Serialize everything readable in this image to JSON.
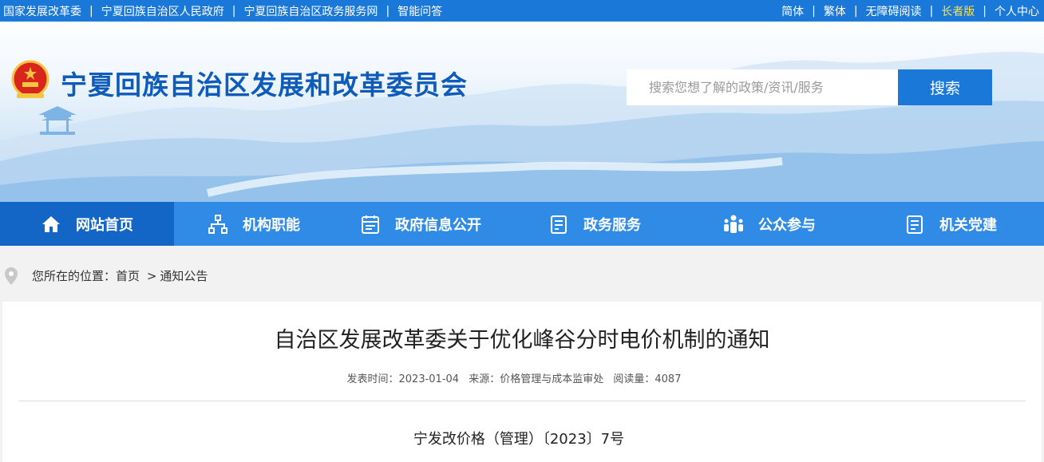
{
  "topbar": {
    "links": [
      "国家发展改革委",
      "宁夏回族自治区人民政府",
      "宁夏回族自治区政务服务网",
      "智能问答"
    ],
    "right": [
      "简体",
      "繁体",
      "无障碍阅读",
      "长者版",
      "个人中心"
    ]
  },
  "header": {
    "site_title": "宁夏回族自治区发展和改革委员会",
    "emblem_icon": "national-emblem-icon",
    "search_placeholder": "搜索您想了解的政策/资讯/服务",
    "search_button": "搜索"
  },
  "nav": {
    "items": [
      {
        "label": "网站首页",
        "icon": "home-icon"
      },
      {
        "label": "机构职能",
        "icon": "org-chart-icon"
      },
      {
        "label": "政府信息公开",
        "icon": "calendar-doc-icon"
      },
      {
        "label": "政务服务",
        "icon": "service-doc-icon"
      },
      {
        "label": "公众参与",
        "icon": "people-icon"
      },
      {
        "label": "机关党建",
        "icon": "party-doc-icon"
      }
    ]
  },
  "breadcrumb": {
    "prefix": "您所在的位置：",
    "home": "首页",
    "separator": ">",
    "current": "通知公告"
  },
  "article": {
    "title": "自治区发展改革委关于优化峰谷分时电价机制的通知",
    "publish_time": "发表时间：2023-01-04",
    "source": "来源：价格管理与成本监审处",
    "read_count": "阅读量：4087",
    "doc_number": "宁发改价格（管理）〔2023〕7号"
  },
  "colors": {
    "topbar": "#1a78d9",
    "nav": "#2f8be6",
    "nav_active": "#1366c6",
    "title": "#0e5bb9",
    "elder_link": "#ffe14a"
  }
}
